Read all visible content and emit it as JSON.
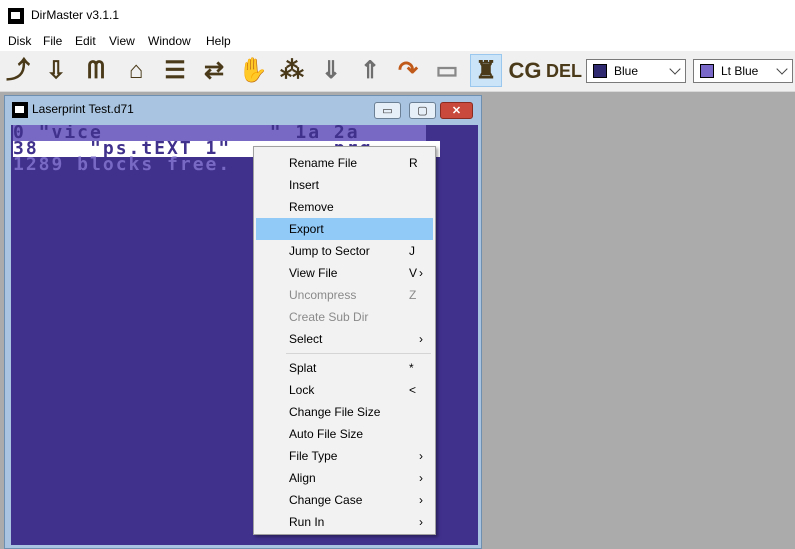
{
  "app": {
    "title": "DirMaster v3.1.1"
  },
  "menu": [
    "Disk",
    "File",
    "Edit",
    "View",
    "Window",
    "Help"
  ],
  "toolbar": {
    "buttons": [
      {
        "icon": "open-disk-icon"
      },
      {
        "icon": "import-icon"
      },
      {
        "icon": "binoculars-icon"
      },
      {
        "icon": "home-icon"
      },
      {
        "icon": "stack-icon"
      },
      {
        "icon": "convert-icon"
      },
      {
        "icon": "hands-icon"
      },
      {
        "icon": "palette-icon"
      },
      {
        "icon": "move-down-icon"
      },
      {
        "icon": "move-up-icon"
      },
      {
        "icon": "redo-icon"
      },
      {
        "icon": "folder-icon"
      },
      {
        "icon": "petscii-icon"
      },
      {
        "icon": "charset-icon",
        "label": "CG"
      },
      {
        "icon": "delete-icon",
        "label": "DEL"
      }
    ],
    "combo1": {
      "value": "Blue",
      "color": "#2f2a6f"
    },
    "combo2": {
      "value": "Lt Blue",
      "color": "#7a68c8"
    }
  },
  "window": {
    "title": "Laserprint Test.d71",
    "min": "▭",
    "max": "▢",
    "close": "✕"
  },
  "listing": {
    "header": "0 \"vice             \" 1a 2a",
    "file": "38    \"ps.tEXT 1\"        prg",
    "free": "1289 blocks free."
  },
  "context_menu": [
    {
      "label": "Rename File",
      "key": "R",
      "submenu": false,
      "disabled": false,
      "highlighted": false
    },
    {
      "label": "Insert",
      "key": "",
      "submenu": false,
      "disabled": false,
      "highlighted": false
    },
    {
      "label": "Remove",
      "key": "",
      "submenu": false,
      "disabled": false,
      "highlighted": false
    },
    {
      "label": "Export",
      "key": "",
      "submenu": false,
      "disabled": false,
      "highlighted": true
    },
    {
      "label": "Jump to Sector",
      "key": "J",
      "submenu": false,
      "disabled": false,
      "highlighted": false
    },
    {
      "label": "View File",
      "key": "V",
      "submenu": true,
      "disabled": false,
      "highlighted": false
    },
    {
      "label": "Uncompress",
      "key": "Z",
      "submenu": false,
      "disabled": true,
      "highlighted": false
    },
    {
      "label": "Create Sub Dir",
      "key": "",
      "submenu": false,
      "disabled": true,
      "highlighted": false
    },
    {
      "label": "Select",
      "key": "",
      "submenu": true,
      "disabled": false,
      "highlighted": false
    },
    {
      "label": "Splat",
      "key": "*",
      "submenu": false,
      "disabled": false,
      "highlighted": false
    },
    {
      "label": "Lock",
      "key": "<",
      "submenu": false,
      "disabled": false,
      "highlighted": false
    },
    {
      "label": "Change File Size",
      "key": "",
      "submenu": false,
      "disabled": false,
      "highlighted": false
    },
    {
      "label": "Auto File Size",
      "key": "",
      "submenu": false,
      "disabled": false,
      "highlighted": false
    },
    {
      "label": "File Type",
      "key": "",
      "submenu": true,
      "disabled": false,
      "highlighted": false
    },
    {
      "label": "Align",
      "key": "",
      "submenu": true,
      "disabled": false,
      "highlighted": false
    },
    {
      "label": "Change Case",
      "key": "",
      "submenu": true,
      "disabled": false,
      "highlighted": false
    },
    {
      "label": "Run In",
      "key": "",
      "submenu": true,
      "disabled": false,
      "highlighted": false
    }
  ]
}
